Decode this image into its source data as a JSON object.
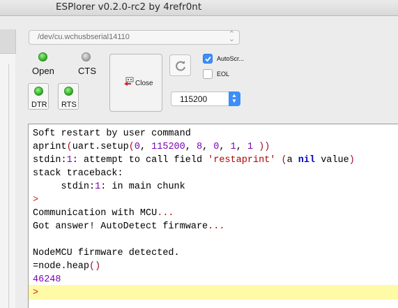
{
  "window": {
    "title": "ESPlorer v0.2.0-rc2 by 4refr0nt"
  },
  "port": {
    "selected": "/dev/cu.wchusbserial14110"
  },
  "connection": {
    "open_label": "Open",
    "cts_label": "CTS",
    "dtr_label": "DTR",
    "rts_label": "RTS",
    "close_label": "Close",
    "autoscroll_label": "AutoScr...",
    "autoscroll_checked": true,
    "eol_label": "EOL",
    "eol_checked": false,
    "baud": "115200"
  },
  "icons": {
    "open_led": "led-green-icon",
    "cts_led": "led-gray-icon",
    "dtr_led": "led-green-icon",
    "rts_led": "led-green-icon",
    "close": "port-close-icon",
    "refresh": "refresh-icon"
  },
  "colors": {
    "accent": "#3d8ef7",
    "led_on": "#34b72a",
    "led_off": "#a9a9a9",
    "number": "#7b00b5",
    "string": "#b40000",
    "keyword": "#0000c4",
    "highlight": "#fffaa6"
  },
  "terminal": {
    "lines": [
      "Soft restart by user command",
      "aprint(uart.setup(0, 115200, 8, 0, 1, 1 ))",
      "stdin:1: attempt to call field 'restaprint' (a nil value)",
      "stack traceback:",
      "     stdin:1: in main chunk",
      ">",
      "Communication with MCU...",
      "Got answer! AutoDetect firmware...",
      "",
      "NodeMCU firmware detected.",
      "=node.heap()",
      "46248",
      ">"
    ]
  }
}
